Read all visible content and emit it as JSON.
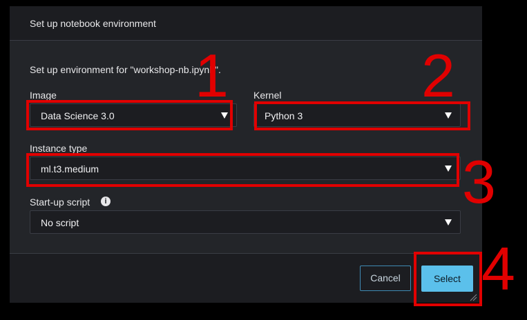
{
  "dialog": {
    "title": "Set up notebook environment",
    "description": "Set up environment for \"workshop-nb.ipynb\".",
    "image": {
      "label": "Image",
      "value": "Data Science 3.0"
    },
    "kernel": {
      "label": "Kernel",
      "value": "Python 3"
    },
    "instance_type": {
      "label": "Instance type",
      "value": "ml.t3.medium"
    },
    "startup_script": {
      "label": "Start-up script",
      "value": "No script",
      "info_icon": "info-icon"
    },
    "buttons": {
      "cancel": "Cancel",
      "select": "Select"
    }
  },
  "annotations": {
    "color": "#e10000",
    "numbers": [
      "1",
      "2",
      "3",
      "4"
    ]
  },
  "colors": {
    "dialog_bg": "#232529",
    "header_bg": "#1c1d21",
    "primary_button": "#5bc0eb",
    "cancel_border": "#3f8bb5"
  }
}
